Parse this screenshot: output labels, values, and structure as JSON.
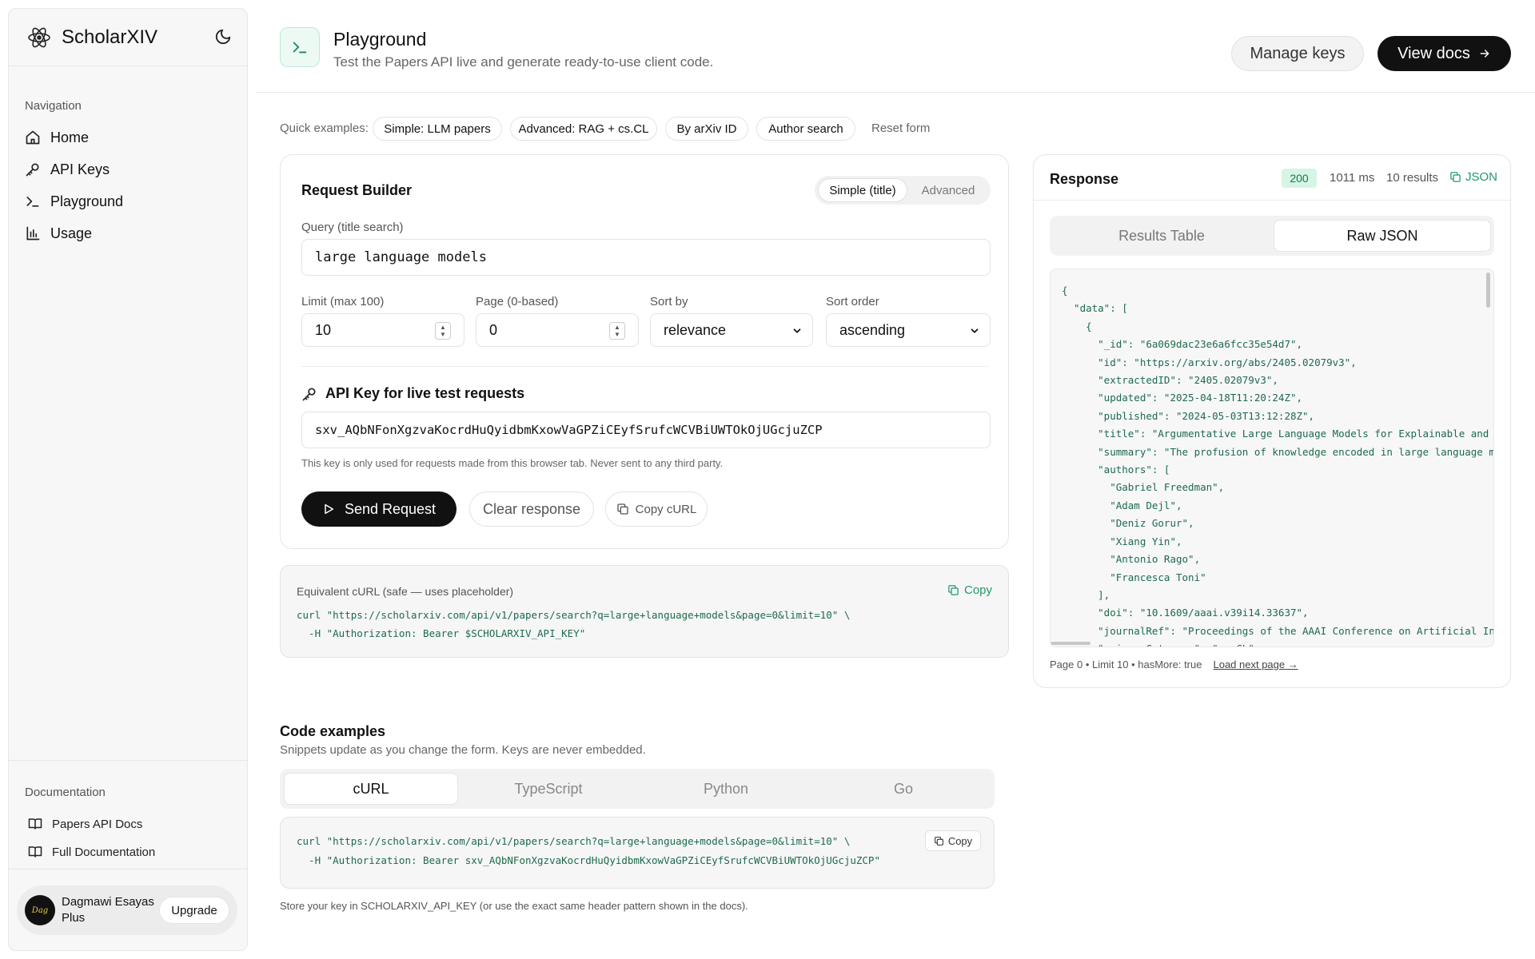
{
  "sidebar": {
    "app_name": "ScholarXIV",
    "nav_label": "Navigation",
    "nav": [
      {
        "label": "Home",
        "icon": "home-icon"
      },
      {
        "label": "API Keys",
        "icon": "key-icon"
      },
      {
        "label": "Playground",
        "icon": "terminal-icon"
      },
      {
        "label": "Usage",
        "icon": "bar-chart-icon"
      }
    ],
    "docs_label": "Documentation",
    "docs": [
      {
        "label": "Papers API Docs",
        "icon": "book-icon"
      },
      {
        "label": "Full Documentation",
        "icon": "book-icon"
      }
    ],
    "user": {
      "name": "Dagmawi Esayas",
      "plan": "Plus",
      "upgrade_label": "Upgrade",
      "avatar_text": "Dag"
    }
  },
  "header": {
    "title": "Playground",
    "subtitle": "Test the Papers API live and generate ready-to-use client code.",
    "manage_keys": "Manage keys",
    "view_docs": "View docs",
    "accent": "#148a5b"
  },
  "quick_examples": {
    "label": "Quick examples:",
    "chips": [
      "Simple: LLM papers",
      "Advanced: RAG + cs.CL",
      "By arXiv ID",
      "Author search"
    ],
    "reset": "Reset form"
  },
  "request_builder": {
    "title": "Request Builder",
    "mode_simple": "Simple (title)",
    "mode_advanced": "Advanced",
    "query_label": "Query (title search)",
    "query_value": "large language models",
    "limit_label": "Limit (max 100)",
    "limit_value": "10",
    "page_label": "Page (0-based)",
    "page_value": "0",
    "sort_by_label": "Sort by",
    "sort_by_value": "relevance",
    "sort_order_label": "Sort order",
    "sort_order_value": "ascending",
    "api_key_title": "API Key for live test requests",
    "api_key_value": "sxv_AQbNFonXgzvaKocrdHuQyidbmKxowVaGPZiCEyfSrufcWCVBiUWTOkOjUGcjuZCP",
    "api_key_note": "This key is only used for requests made from this browser tab. Never sent to any third party.",
    "send": "Send Request",
    "clear": "Clear response",
    "copy_curl": "Copy cURL"
  },
  "equivalent_curl": {
    "title": "Equivalent cURL (safe — uses placeholder)",
    "copy": "Copy",
    "line1": "curl \"https://scholarxiv.com/api/v1/papers/search?q=large+language+models&page=0&limit=10\" \\",
    "line2": "  -H \"Authorization: Bearer $SCHOLARXIV_API_KEY\""
  },
  "code_examples": {
    "title": "Code examples",
    "subtitle": "Snippets update as you change the form. Keys are never embedded.",
    "tabs": [
      "cURL",
      "TypeScript",
      "Python",
      "Go"
    ],
    "copy": "Copy",
    "line1": "curl \"https://scholarxiv.com/api/v1/papers/search?q=large+language+models&page=0&limit=10\" \\",
    "line2": "  -H \"Authorization: Bearer sxv_AQbNFonXgzvaKocrdHuQyidbmKxowVaGPZiCEyfSrufcWCVBiUWTOkOjUGcjuZCP\"",
    "note": "Store your key in SCHOLARXIV_API_KEY (or use the exact same header pattern shown in the docs)."
  },
  "response": {
    "title": "Response",
    "status": "200",
    "time": "1011 ms",
    "count": "10 results",
    "json_label": "JSON",
    "tabs": [
      "Results Table",
      "Raw JSON"
    ],
    "json_lines": [
      "{",
      "  \"data\": [",
      "    {",
      "      \"_id\": \"6a069dac23e6a6fcc35e54d7\",",
      "      \"id\": \"https://arxiv.org/abs/2405.02079v3\",",
      "      \"extractedID\": \"2405.02079v3\",",
      "      \"updated\": \"2025-04-18T11:20:24Z\",",
      "      \"published\": \"2024-05-03T13:12:28Z\",",
      "      \"title\": \"Argumentative Large Language Models for Explainable and",
      "      \"summary\": \"The profusion of knowledge encoded in large language m",
      "      \"authors\": [",
      "        \"Gabriel Freedman\",",
      "        \"Adam Dejl\",",
      "        \"Deniz Gorur\",",
      "        \"Xiang Yin\",",
      "        \"Antonio Rago\",",
      "        \"Francesca Toni\"",
      "      ],",
      "      \"doi\": \"10.1609/aaai.v39i14.33637\",",
      "      \"journalRef\": \"Proceedings of the AAAI Conference on Artificial In",
      "      \"primaryCategory\": \"cs.CL\","
    ],
    "pager_info": "Page 0 • Limit 10 • hasMore: true",
    "load_next": "Load next page →"
  }
}
